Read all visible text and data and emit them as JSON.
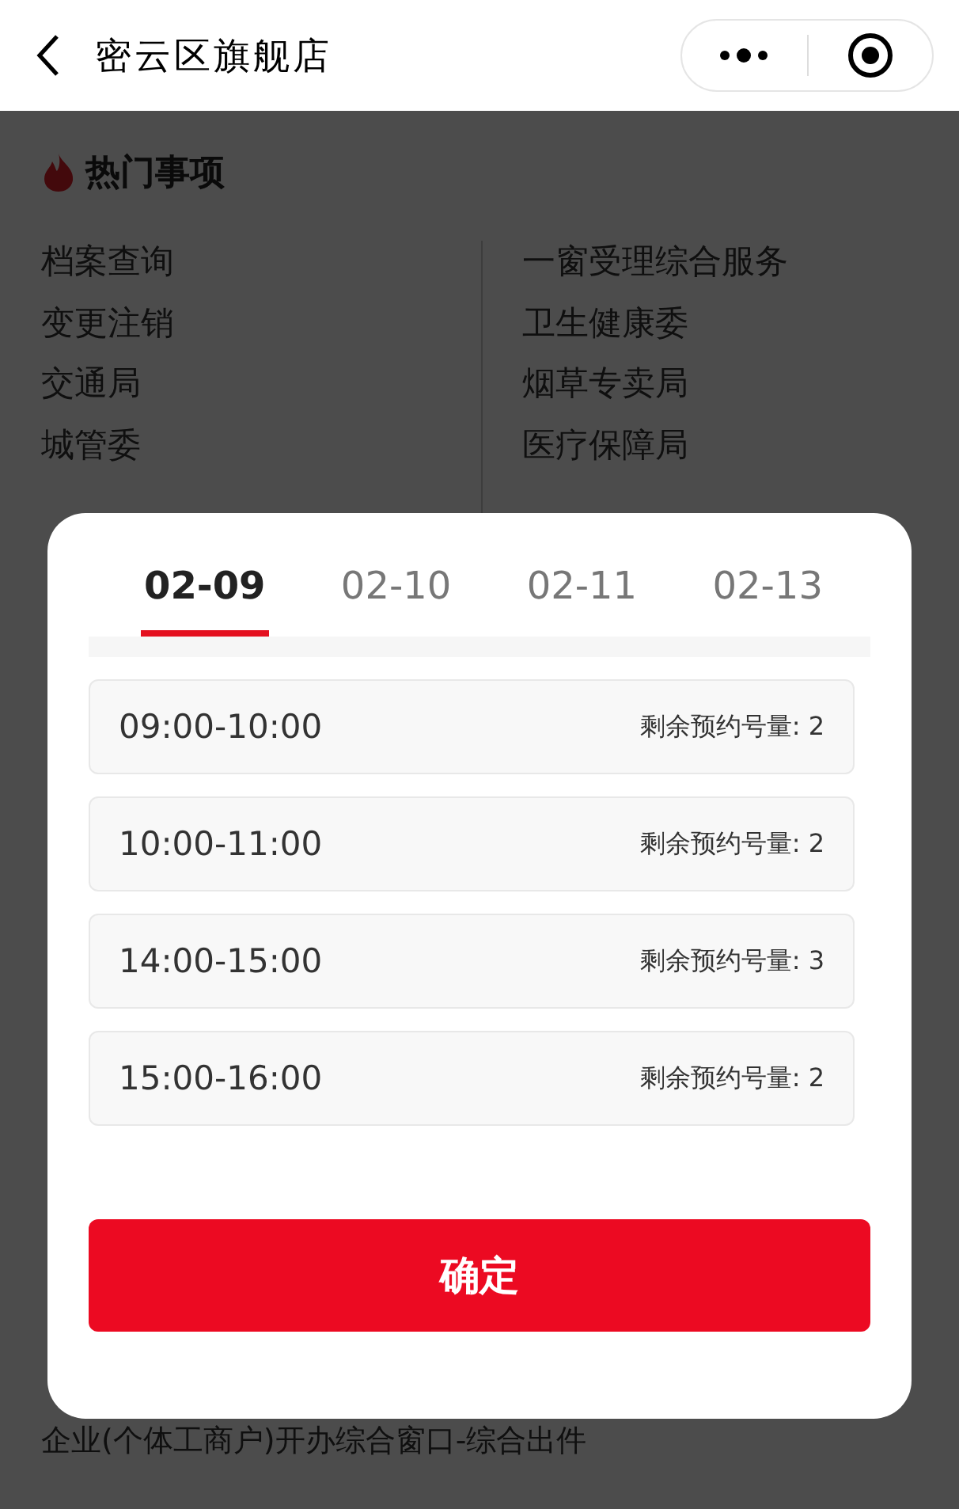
{
  "nav_bar": {
    "title": "密云区旗舰店"
  },
  "hot_items": {
    "title": "热门事项",
    "left": [
      "档案查询",
      "变更注销",
      "交通局",
      "城管委"
    ],
    "right": [
      "一窗受理综合服务",
      "卫生健康委",
      "烟草专卖局",
      "医疗保障局"
    ]
  },
  "footer_item": "企业(个体工商户)开办综合窗口-综合出件",
  "modal": {
    "tabs": [
      {
        "label": "02-09",
        "selected": true
      },
      {
        "label": "02-10",
        "selected": false
      },
      {
        "label": "02-11",
        "selected": false
      },
      {
        "label": "02-13",
        "selected": false
      }
    ],
    "slots": [
      {
        "time": "09:00-10:00",
        "remaining": "剩余预约号量: 2"
      },
      {
        "time": "10:00-11:00",
        "remaining": "剩余预约号量: 2"
      },
      {
        "time": "14:00-15:00",
        "remaining": "剩余预约号量: 3"
      },
      {
        "time": "15:00-16:00",
        "remaining": "剩余预约号量: 2"
      }
    ],
    "confirm": "确定"
  }
}
